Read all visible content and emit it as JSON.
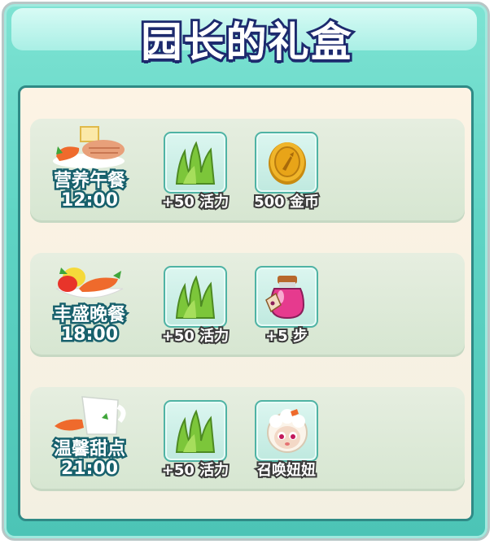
{
  "title": "园长的礼盒",
  "meals": [
    {
      "name": "营养午餐",
      "time": "12:00",
      "icon": "lunch-tray-icon",
      "rewards": [
        {
          "icon": "grass-icon",
          "label": "+50 活力"
        },
        {
          "icon": "gold-coin-icon",
          "label": "500 金币"
        }
      ]
    },
    {
      "name": "丰盛晚餐",
      "time": "18:00",
      "icon": "dinner-plate-icon",
      "rewards": [
        {
          "icon": "grass-icon",
          "label": "+50 活力"
        },
        {
          "icon": "potion-jar-icon",
          "label": "+5 步"
        }
      ]
    },
    {
      "name": "温馨甜点",
      "time": "21:00",
      "icon": "dessert-cup-icon",
      "rewards": [
        {
          "icon": "grass-icon",
          "label": "+50 活力"
        },
        {
          "icon": "sheep-avatar-icon",
          "label": "召唤妞妞"
        }
      ]
    }
  ]
}
